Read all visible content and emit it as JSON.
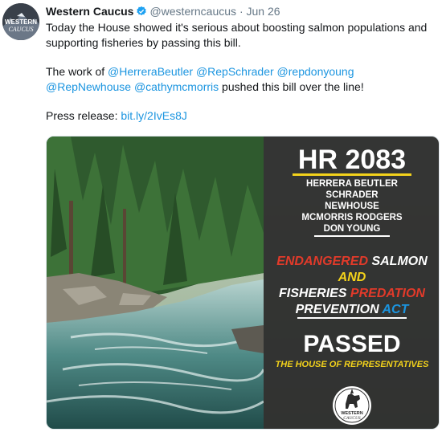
{
  "tweet": {
    "author_name": "Western Caucus",
    "handle": "@westerncaucus",
    "separator": "·",
    "date": "Jun 26",
    "avatar_text_top": "WESTERN",
    "avatar_text_bottom": "CAUCUS",
    "line1": "Today the House showed it's serious about boosting salmon populations and supporting fisheries by passing this bill.",
    "line2_prefix": "The work of ",
    "mentions": [
      "@HerreraBeutler",
      "@RepSchrader",
      "@repdonyoung",
      "@RepNewhouse",
      "@cathymcmorris"
    ],
    "line2_suffix": " pushed this bill over the line!",
    "press_label": "Press release: ",
    "press_link": "bit.ly/2IvEs8J"
  },
  "image": {
    "bill": "HR 2083",
    "sponsors": [
      "HERRERA BEUTLER",
      "SCHRADER",
      "NEWHOUSE",
      "MCMORRIS RODGERS",
      "DON YOUNG"
    ],
    "title_endangered": "ENDANGERED",
    "title_salmon": " SALMON",
    "title_and": "AND",
    "title_fisheries": "FISHERIES ",
    "title_predation": "PREDATION",
    "title_prevention": "PREVENTION ",
    "title_act": "ACT",
    "passed": "PASSED",
    "passed_by": "THE HOUSE OF REPRESENTATIVES",
    "logo_text": "WESTERN",
    "logo_text2": "CAUCUS"
  },
  "colors": {
    "accent_blue": "#1b95e0",
    "red": "#e23a2a",
    "yellow": "#f3d21b",
    "panel": "#2c2c2c"
  }
}
